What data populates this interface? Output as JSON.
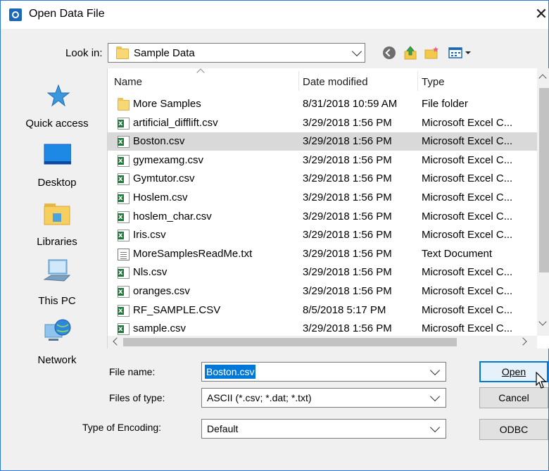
{
  "window": {
    "title": "Open Data File",
    "close_glyph": "✕"
  },
  "look_in": {
    "label": "Look in:",
    "value": "Sample Data"
  },
  "places": [
    {
      "label": "Quick access",
      "icon": "star-icon"
    },
    {
      "label": "Desktop",
      "icon": "desktop-icon"
    },
    {
      "label": "Libraries",
      "icon": "libraries-icon"
    },
    {
      "label": "This PC",
      "icon": "computer-icon"
    },
    {
      "label": "Network",
      "icon": "network-icon"
    }
  ],
  "columns": {
    "name": "Name",
    "date": "Date modified",
    "type": "Type"
  },
  "files": [
    {
      "name": "More Samples",
      "date": "8/31/2018 10:59 AM",
      "type": "File folder",
      "icon": "folder-icon"
    },
    {
      "name": "artificial_difflift.csv",
      "date": "3/29/2018 1:56 PM",
      "type": "Microsoft Excel C...",
      "icon": "excel-csv-icon"
    },
    {
      "name": "Boston.csv",
      "date": "3/29/2018 1:56 PM",
      "type": "Microsoft Excel C...",
      "icon": "excel-csv-icon",
      "selected": true
    },
    {
      "name": "gymexamg.csv",
      "date": "3/29/2018 1:56 PM",
      "type": "Microsoft Excel C...",
      "icon": "excel-csv-icon"
    },
    {
      "name": "Gymtutor.csv",
      "date": "3/29/2018 1:56 PM",
      "type": "Microsoft Excel C...",
      "icon": "excel-csv-icon"
    },
    {
      "name": "Hoslem.csv",
      "date": "3/29/2018 1:56 PM",
      "type": "Microsoft Excel C...",
      "icon": "excel-csv-icon"
    },
    {
      "name": "hoslem_char.csv",
      "date": "3/29/2018 1:56 PM",
      "type": "Microsoft Excel C...",
      "icon": "excel-csv-icon"
    },
    {
      "name": "Iris.csv",
      "date": "3/29/2018 1:56 PM",
      "type": "Microsoft Excel C...",
      "icon": "excel-csv-icon"
    },
    {
      "name": "MoreSamplesReadMe.txt",
      "date": "3/29/2018 1:56 PM",
      "type": "Text Document",
      "icon": "text-document-icon"
    },
    {
      "name": "Nls.csv",
      "date": "3/29/2018 1:56 PM",
      "type": "Microsoft Excel C...",
      "icon": "excel-csv-icon"
    },
    {
      "name": "oranges.csv",
      "date": "3/29/2018 1:56 PM",
      "type": "Microsoft Excel C...",
      "icon": "excel-csv-icon"
    },
    {
      "name": "RF_SAMPLE.CSV",
      "date": "8/5/2018 5:17 PM",
      "type": "Microsoft Excel C...",
      "icon": "excel-csv-icon"
    },
    {
      "name": "sample.csv",
      "date": "3/29/2018 1:56 PM",
      "type": "Microsoft Excel C...",
      "icon": "excel-csv-icon"
    }
  ],
  "form": {
    "file_name_label": "File name:",
    "file_name_value": "Boston.csv",
    "files_of_type_label": "Files of type:",
    "files_of_type_value": "ASCII (*.csv; *.dat; *.txt)",
    "encoding_label": "Type of Encoding:",
    "encoding_value": "Default"
  },
  "buttons": {
    "open": "Open",
    "cancel": "Cancel",
    "odbc": "ODBC"
  },
  "colors": {
    "accent": "#0078d7",
    "selection_row": "#d9d9d9",
    "window_border": "#2b7bd6"
  }
}
